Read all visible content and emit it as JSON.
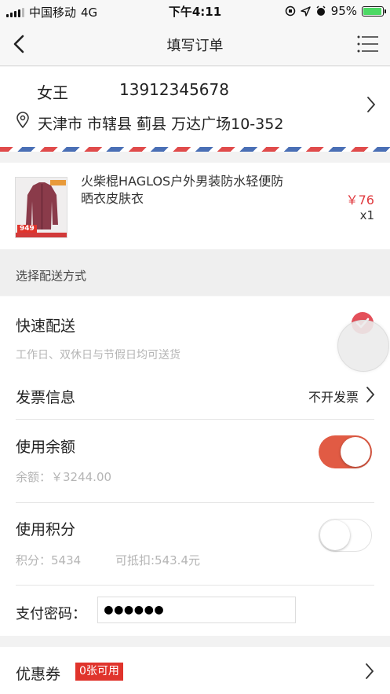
{
  "status_bar": {
    "carrier": "中国移动",
    "network": "4G",
    "time": "下午4:11",
    "battery": "95%"
  },
  "nav": {
    "title": "填写订单",
    "back_icon": "chevron-left-icon",
    "menu_icon": "hamburger-menu-icon"
  },
  "address": {
    "name": "女王",
    "phone": "13912345678",
    "detail": "天津市 市辖县 蓟县 万达广场10-352"
  },
  "product": {
    "title": "火柴棍HAGLOS户外男装防水轻便防晒衣皮肤衣",
    "price": "￥76",
    "quantity": "x1",
    "thumb_badge": "949"
  },
  "delivery": {
    "section_label": "选择配送方式",
    "method_title": "快速配送",
    "method_note": "工作日、双休日与节假日均可送货",
    "selected": true
  },
  "invoice": {
    "label": "发票信息",
    "value": "不开发票"
  },
  "balance": {
    "label": "使用余额",
    "sub": "余额：￥3244.00",
    "enabled": true
  },
  "points": {
    "label": "使用积分",
    "points_text": "积分：5434",
    "deduct_text": "可抵扣:543.4元",
    "enabled": false
  },
  "payment": {
    "label": "支付密码：",
    "masked_value": "●●●●●●"
  },
  "coupon": {
    "label": "优惠券",
    "badge": "0张可用"
  },
  "colors": {
    "accent": "#e15b44",
    "price": "#e0393e",
    "badge": "#e0342c"
  }
}
